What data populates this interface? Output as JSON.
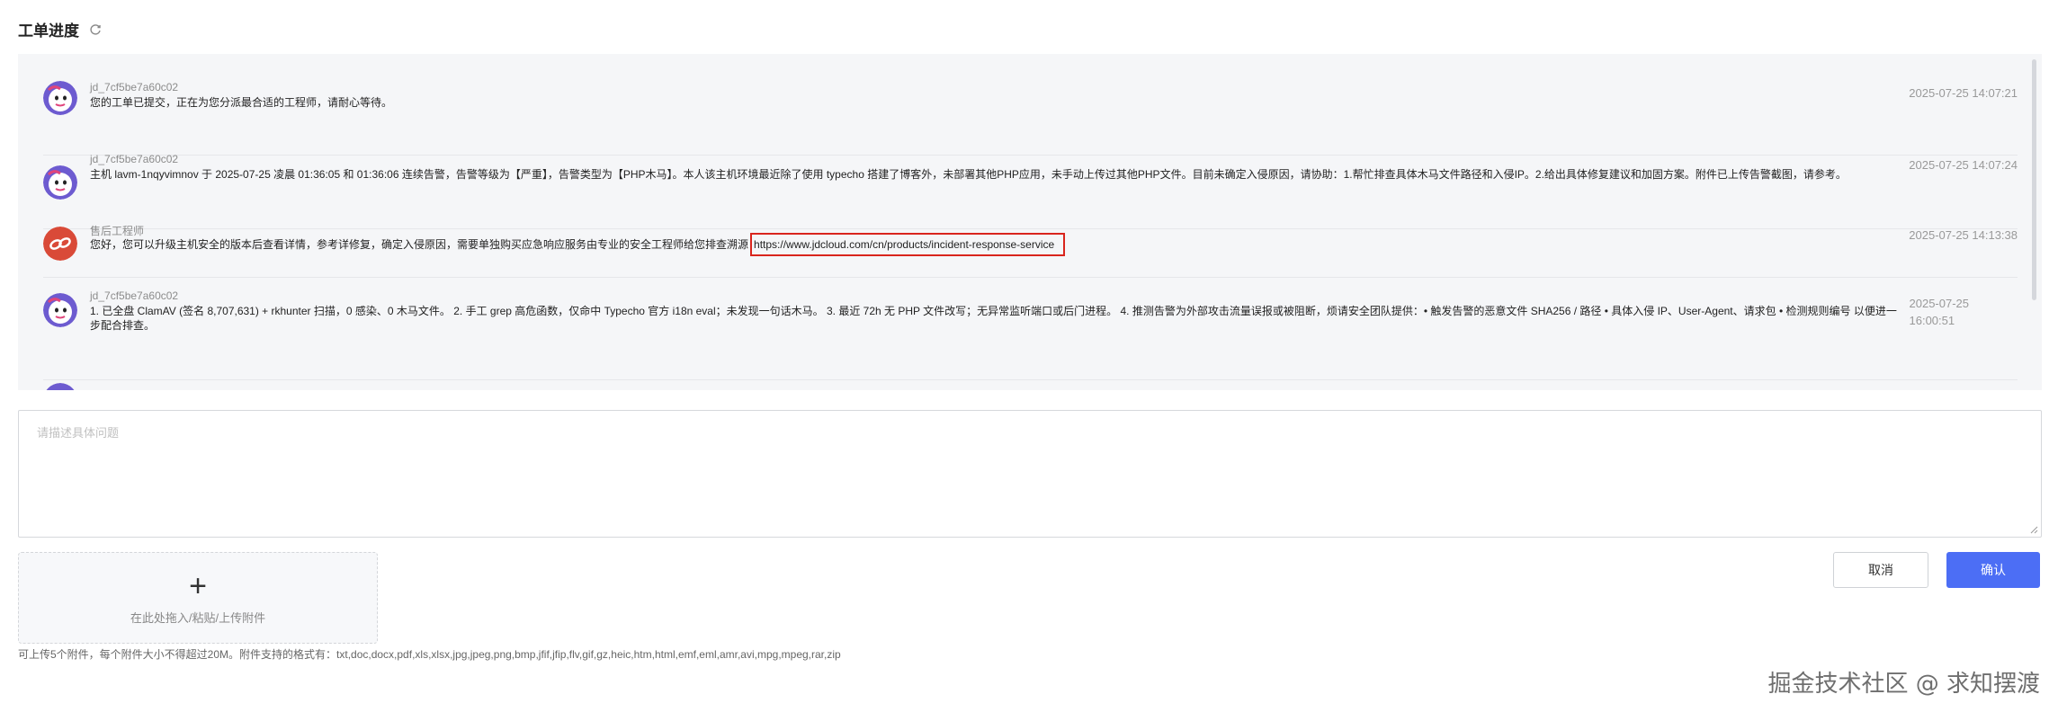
{
  "header": {
    "title": "工单进度",
    "refresh_icon": "refresh-icon"
  },
  "messages": [
    {
      "user": "jd_7cf5be7a60c02",
      "text": "您的工单已提交，正在为您分派最合适的工程师，请耐心等待。",
      "time": "2025-07-25 14:07:21",
      "avatar": "user-avatar-icon"
    },
    {
      "user": "jd_7cf5be7a60c02",
      "text": "主机 lavm-1nqyvimnov 于 2025-07-25 凌晨 01:36:05 和 01:36:06 连续告警，告警等级为【严重】，告警类型为【PHP木马】。本人该主机环境最近除了使用 typecho 搭建了博客外，未部署其他PHP应用，未手动上传过其他PHP文件。目前未确定入侵原因，请协助：1.帮忙排查具体木马文件路径和入侵IP。2.给出具体修复建议和加固方案。附件已上传告警截图，请参考。",
      "time": "2025-07-25 14:07:24",
      "avatar": "user-avatar-icon"
    },
    {
      "user": "售后工程师",
      "text": "您好，您可以升级主机安全的版本后查看详情，参考详修复，确定入侵原因，需要单独购买应急响应服务由专业的安全工程师给您排查溯源",
      "link": "https://www.jdcloud.com/cn/products/incident-response-service",
      "time": "2025-07-25 14:13:38",
      "avatar": "engineer-avatar-icon"
    },
    {
      "user": "jd_7cf5be7a60c02",
      "text_line1": "1. 已全盘 ClamAV (签名 8,707,631) + rkhunter 扫描，0 感染、0 木马文件。 2. 手工 grep 高危函数，仅命中 Typecho 官方 i18n eval；未发现一句话木马。 3. 最近 72h 无 PHP 文件改写；无异常监听端口或后门进程。 4. 推测告警为外部攻击流量误报或被阻断，烦请安全团队提供：• 触发告警的恶意文件 SHA256 / 路径 • 具体入侵 IP、User-Agent、请求包 • 检测规则编号 以便进一",
      "text_line2": "步配合排查。",
      "time_line1": "2025-07-25",
      "time_line2": "16:00:51",
      "avatar": "user-avatar-icon"
    }
  ],
  "input": {
    "placeholder": "请描述具体问题"
  },
  "upload": {
    "plus": "+",
    "label": "在此处拖入/粘贴/上传附件",
    "hint": "可上传5个附件，每个附件大小不得超过20M。附件支持的格式有：txt,doc,docx,pdf,xls,xlsx,jpg,jpeg,png,bmp,jfif,jfip,flv,gif,gz,heic,htm,html,emf,eml,amr,avi,mpg,mpeg,rar,zip"
  },
  "buttons": {
    "cancel": "取消",
    "confirm": "确认"
  },
  "watermark": "掘金技术社区 @ 求知摆渡",
  "colors": {
    "accent": "#4c6ef5",
    "highlight_box": "#d9251d",
    "engineer_avatar": "#d94a38"
  }
}
